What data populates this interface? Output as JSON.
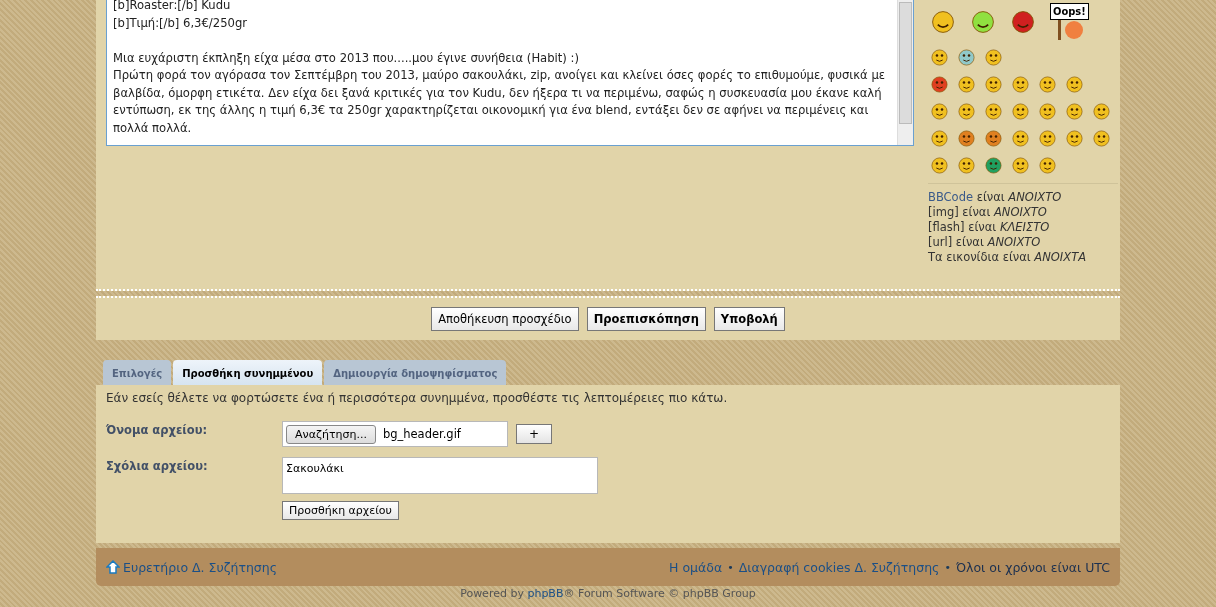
{
  "editor": {
    "lines": [
      "[b]Roaster:[/b] Kudu",
      "[b]Τιμή:[/b] 6,3€/250gr",
      "Μια ευχάριστη έκπληξη είχα μέσα στο 2013 που.....μου έγινε συνήθεια (Habit) :)",
      "Πρώτη φορά τον αγόρασα τον Σεπτέμβρη του 2013, μαύρο σακουλάκι, zip, ανοίγει και κλείνει όσες φορές το επιθυμούμε, φυσικά με βαλβίδα, όμορφη ετικέτα. Δεν είχα δει ξανά κριτικές για τον Kudu, δεν ήξερα τι να περιμένω, σαφώς η συσκευασία μου έκανε καλή εντύπωση, εκ της άλλης η τιμή 6,3€ τα 250gr χαρακτηρίζεται οικονομική για ένα blend, εντάξει δεν σε αφήνει να περιμένεις και πολλά πολλά."
    ]
  },
  "smilies": {
    "oops_sign": "Oops!"
  },
  "status_list": [
    {
      "lead": "BBCode",
      "is_link": true,
      "rest": "είναι",
      "status": "ΑΝΟΙΧΤΟ"
    },
    {
      "lead": "[img]",
      "is_link": false,
      "rest": "είναι",
      "status": "ΑΝΟΙΧΤΟ"
    },
    {
      "lead": "[flash]",
      "is_link": false,
      "rest": "είναι",
      "status": "ΚΛΕΙΣΤΟ"
    },
    {
      "lead": "[url]",
      "is_link": false,
      "rest": "είναι",
      "status": "ΑΝΟΙΧΤΟ"
    },
    {
      "lead": "Τα εικονίδια",
      "is_link": false,
      "rest": "είναι",
      "status": "ΑΝΟΙΧΤΑ"
    }
  ],
  "buttons": [
    {
      "label": "Αποθήκευση προσχέδιο",
      "primary": false
    },
    {
      "label": "Προεπισκόπηση",
      "primary": true
    },
    {
      "label": "Υποβολή",
      "primary": true
    }
  ],
  "tabs": [
    {
      "label": "Επιλογές",
      "selected": false
    },
    {
      "label": "Προσθήκη συνημμένου",
      "selected": true
    },
    {
      "label": "Δημιουργία δημοψηφίσματος",
      "selected": false
    }
  ],
  "attachment": {
    "intro": "Εάν εσείς θέλετε να φορτώσετε ένα ή περισσότερα συνημμένα, προσθέστε τις λεπτομέρειες πιο κάτω.",
    "file_label": "Όνομα αρχείου:",
    "browse_button": "Αναζήτηση...",
    "file_value": "bg_header.gif",
    "plus_button": "+",
    "comment_label": "Σχόλια αρχείου:",
    "comment_value": "Σακουλάκι",
    "add_button": "Προσθήκη αρχείου"
  },
  "footer": {
    "separator": "•",
    "index_link": "Ευρετήριο Δ. Συζήτησης",
    "links": [
      {
        "text": "Η ομάδα",
        "is_link": true
      },
      {
        "text": "Διαγραφή cookies Δ. Συζήτησης",
        "is_link": true
      },
      {
        "text": "Όλοι οι χρόνοι είναι UTC",
        "is_link": false
      }
    ]
  },
  "powered_by": {
    "before": "Powered by",
    "link": "phpBB",
    "after": "® Forum Software © phpBB Group"
  }
}
